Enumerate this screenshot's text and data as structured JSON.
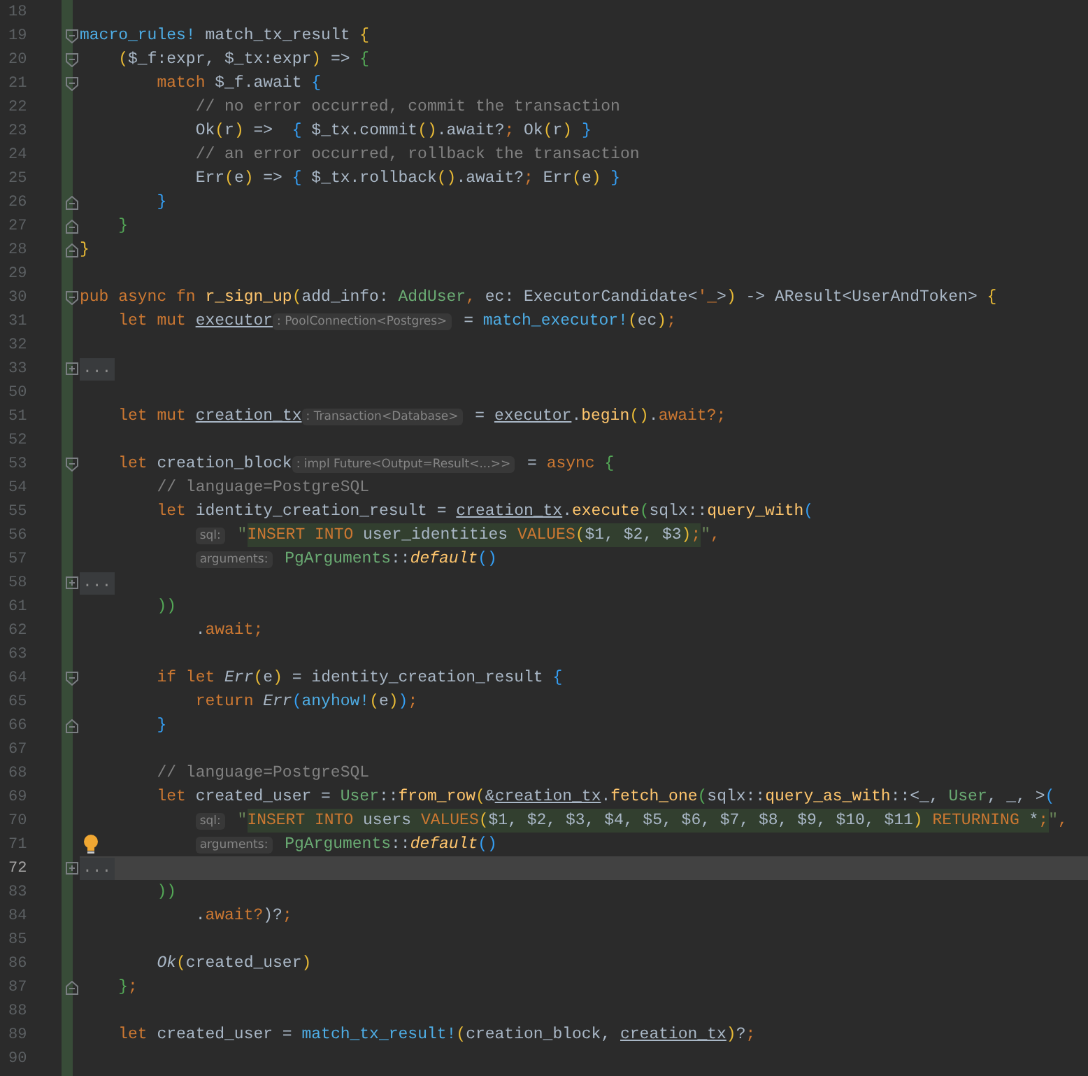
{
  "editor": {
    "lines": [
      {
        "number": "18",
        "kind": "plain",
        "current": false,
        "bulb": false
      },
      {
        "number": "19",
        "kind": "fold-start",
        "current": false,
        "bulb": false,
        "parts": [
          {
            "kind": "code",
            "tokens": [
              {
                "text": "macro_rules!",
                "kind": "macro"
              },
              {
                "text": " match_tx_result ",
                "kind": "plain"
              },
              {
                "text": "{",
                "kind": "bracket-yellow"
              }
            ]
          }
        ]
      },
      {
        "number": "20",
        "kind": "fold-start",
        "current": false,
        "bulb": false,
        "parts": [
          {
            "kind": "code",
            "tokens": [
              {
                "text": "    (",
                "kind": "bracket-yellow"
              },
              {
                "text": "$_f:expr, $_tx:expr",
                "kind": "plain"
              },
              {
                "text": ")",
                "kind": "bracket-yellow"
              },
              {
                "text": " => ",
                "kind": "plain"
              },
              {
                "text": "{",
                "kind": "bracket-green"
              }
            ]
          }
        ]
      },
      {
        "number": "21",
        "kind": "fold-start",
        "current": false,
        "bulb": false,
        "parts": [
          {
            "kind": "code",
            "tokens": [
              {
                "text": "        match",
                "kind": "keyword"
              },
              {
                "text": " $_f.await ",
                "kind": "plain"
              },
              {
                "text": "{",
                "kind": "bracket-blue"
              }
            ]
          }
        ]
      },
      {
        "number": "22",
        "kind": "plain",
        "current": false,
        "bulb": false,
        "parts": [
          {
            "kind": "code",
            "tokens": [
              {
                "text": "            // no error occurred, commit the transaction",
                "kind": "comment"
              }
            ]
          }
        ]
      },
      {
        "number": "23",
        "kind": "plain",
        "current": false,
        "bulb": false,
        "parts": [
          {
            "kind": "code",
            "tokens": [
              {
                "text": "            Ok",
                "kind": "plain"
              },
              {
                "text": "(",
                "kind": "bracket-yellow"
              },
              {
                "text": "r",
                "kind": "plain"
              },
              {
                "text": ")",
                "kind": "bracket-yellow"
              },
              {
                "text": " =>  ",
                "kind": "plain"
              },
              {
                "text": "{",
                "kind": "bracket-blue"
              },
              {
                "text": " $_tx.commit",
                "kind": "plain"
              },
              {
                "text": "()",
                "kind": "bracket-yellow"
              },
              {
                "text": ".await?",
                "kind": "plain"
              },
              {
                "text": ";",
                "kind": "keyword"
              },
              {
                "text": " Ok",
                "kind": "plain"
              },
              {
                "text": "(",
                "kind": "bracket-yellow"
              },
              {
                "text": "r",
                "kind": "plain"
              },
              {
                "text": ")",
                "kind": "bracket-yellow"
              },
              {
                "text": " }",
                "kind": "bracket-blue"
              }
            ]
          }
        ]
      },
      {
        "number": "24",
        "kind": "plain",
        "current": false,
        "bulb": false,
        "parts": [
          {
            "kind": "code",
            "tokens": [
              {
                "text": "            // an error occurred, rollback the transaction",
                "kind": "comment"
              }
            ]
          }
        ]
      },
      {
        "number": "25",
        "kind": "plain",
        "current": false,
        "bulb": false,
        "parts": [
          {
            "kind": "code",
            "tokens": [
              {
                "text": "            Err",
                "kind": "plain"
              },
              {
                "text": "(",
                "kind": "bracket-yellow"
              },
              {
                "text": "e",
                "kind": "plain"
              },
              {
                "text": ")",
                "kind": "bracket-yellow"
              },
              {
                "text": " => ",
                "kind": "plain"
              },
              {
                "text": "{",
                "kind": "bracket-blue"
              },
              {
                "text": " $_tx.rollback",
                "kind": "plain"
              },
              {
                "text": "()",
                "kind": "bracket-yellow"
              },
              {
                "text": ".await?",
                "kind": "plain"
              },
              {
                "text": ";",
                "kind": "keyword"
              },
              {
                "text": " Err",
                "kind": "plain"
              },
              {
                "text": "(",
                "kind": "bracket-yellow"
              },
              {
                "text": "e",
                "kind": "plain"
              },
              {
                "text": ")",
                "kind": "bracket-yellow"
              },
              {
                "text": " }",
                "kind": "bracket-blue"
              }
            ]
          }
        ]
      },
      {
        "number": "26",
        "kind": "fold-end",
        "current": false,
        "bulb": false,
        "parts": [
          {
            "kind": "code",
            "tokens": [
              {
                "text": "        }",
                "kind": "bracket-blue"
              }
            ]
          }
        ]
      },
      {
        "number": "27",
        "kind": "fold-end",
        "current": false,
        "bulb": false,
        "parts": [
          {
            "kind": "code",
            "tokens": [
              {
                "text": "    }",
                "kind": "bracket-green"
              }
            ]
          }
        ]
      },
      {
        "number": "28",
        "kind": "fold-end",
        "current": false,
        "bulb": false,
        "parts": [
          {
            "kind": "code",
            "tokens": [
              {
                "text": "}",
                "kind": "bracket-yellow"
              }
            ]
          }
        ]
      },
      {
        "number": "29",
        "kind": "plain",
        "current": false,
        "bulb": false
      },
      {
        "number": "30",
        "kind": "fold-start",
        "current": false,
        "bulb": false,
        "parts": [
          {
            "kind": "code",
            "tokens": [
              {
                "text": "pub async fn ",
                "kind": "keyword"
              },
              {
                "text": "r_sign_up",
                "kind": "function"
              },
              {
                "text": "(",
                "kind": "bracket-yellow"
              },
              {
                "text": "add_info: ",
                "kind": "plain"
              },
              {
                "text": "AddUser",
                "kind": "type"
              },
              {
                "text": ", ",
                "kind": "keyword"
              },
              {
                "text": "ec: ExecutorCandidate<",
                "kind": "plain"
              },
              {
                "text": "'_",
                "kind": "keyword"
              },
              {
                "text": ">",
                "kind": "plain"
              },
              {
                "text": ")",
                "kind": "bracket-yellow"
              },
              {
                "text": " -> AResult<UserAndToken> ",
                "kind": "plain"
              },
              {
                "text": "{",
                "kind": "bracket-yellow"
              }
            ]
          }
        ]
      },
      {
        "number": "31",
        "kind": "plain",
        "current": false,
        "bulb": false,
        "parts": [
          {
            "kind": "code",
            "tokens": [
              {
                "text": "    let mut ",
                "kind": "keyword"
              },
              {
                "text": "executor",
                "kind": "mutable"
              }
            ]
          },
          {
            "kind": "hint",
            "text": ": PoolConnection<Postgres>"
          },
          {
            "kind": "code",
            "tokens": [
              {
                "text": " = ",
                "kind": "plain"
              },
              {
                "text": "match_executor!",
                "kind": "macro"
              },
              {
                "text": "(",
                "kind": "bracket-yellow"
              },
              {
                "text": "ec",
                "kind": "plain"
              },
              {
                "text": ")",
                "kind": "bracket-yellow"
              },
              {
                "text": ";",
                "kind": "keyword"
              }
            ]
          }
        ]
      },
      {
        "number": "32",
        "kind": "plain",
        "current": false,
        "bulb": false
      },
      {
        "number": "33",
        "kind": "folded",
        "current": false,
        "bulb": false,
        "parts": [
          {
            "kind": "fold",
            "text": "..."
          }
        ]
      },
      {
        "number": "50",
        "kind": "plain",
        "current": false,
        "bulb": false
      },
      {
        "number": "51",
        "kind": "plain",
        "current": false,
        "bulb": false,
        "parts": [
          {
            "kind": "code",
            "tokens": [
              {
                "text": "    let mut ",
                "kind": "keyword"
              },
              {
                "text": "creation_tx",
                "kind": "mutable"
              }
            ]
          },
          {
            "kind": "hint",
            "text": ": Transaction<Database>"
          },
          {
            "kind": "code",
            "tokens": [
              {
                "text": " = ",
                "kind": "plain"
              },
              {
                "text": "executor",
                "kind": "mutable"
              },
              {
                "text": ".",
                "kind": "plain"
              },
              {
                "text": "begin",
                "kind": "function"
              },
              {
                "text": "()",
                "kind": "bracket-yellow"
              },
              {
                "text": ".",
                "kind": "plain"
              },
              {
                "text": "await?;",
                "kind": "keyword"
              }
            ]
          }
        ]
      },
      {
        "number": "52",
        "kind": "plain",
        "current": false,
        "bulb": false
      },
      {
        "number": "53",
        "kind": "fold-start",
        "current": false,
        "bulb": false,
        "parts": [
          {
            "kind": "code",
            "tokens": [
              {
                "text": "    let ",
                "kind": "keyword"
              },
              {
                "text": "creation_block",
                "kind": "plain"
              }
            ]
          },
          {
            "kind": "hint",
            "text": ": impl Future<Output=Result<...>>"
          },
          {
            "kind": "code",
            "tokens": [
              {
                "text": " = ",
                "kind": "plain"
              },
              {
                "text": "async ",
                "kind": "keyword"
              },
              {
                "text": "{",
                "kind": "bracket-green"
              }
            ]
          }
        ]
      },
      {
        "number": "54",
        "kind": "plain",
        "current": false,
        "bulb": false,
        "parts": [
          {
            "kind": "code",
            "tokens": [
              {
                "text": "        // language=PostgreSQL",
                "kind": "comment"
              }
            ]
          }
        ]
      },
      {
        "number": "55",
        "kind": "plain",
        "current": false,
        "bulb": false,
        "parts": [
          {
            "kind": "code",
            "tokens": [
              {
                "text": "        let ",
                "kind": "keyword"
              },
              {
                "text": "identity_creation_result = ",
                "kind": "plain"
              },
              {
                "text": "creation_tx",
                "kind": "mutable"
              },
              {
                "text": ".",
                "kind": "plain"
              },
              {
                "text": "execute",
                "kind": "function"
              },
              {
                "text": "(",
                "kind": "bracket-green"
              },
              {
                "text": "sqlx::",
                "kind": "plain"
              },
              {
                "text": "query_with",
                "kind": "function"
              },
              {
                "text": "(",
                "kind": "bracket-blue"
              }
            ]
          }
        ]
      },
      {
        "number": "56",
        "kind": "plain",
        "current": false,
        "bulb": false,
        "parts": [
          {
            "kind": "hint",
            "text": "            sql:"
          },
          {
            "kind": "code",
            "tokens": [
              {
                "text": " \"",
                "kind": "string"
              }
            ]
          },
          {
            "kind": "injected",
            "tokens": [
              {
                "text": "INSERT INTO",
                "kind": "keyword"
              },
              {
                "text": " user_identities ",
                "kind": "plain"
              },
              {
                "text": "VALUES",
                "kind": "keyword"
              },
              {
                "text": "(",
                "kind": "bracket-yellow"
              },
              {
                "text": "$1, $2, $3",
                "kind": "plain"
              },
              {
                "text": ")",
                "kind": "bracket-yellow"
              },
              {
                "text": ";",
                "kind": "keyword"
              }
            ]
          },
          {
            "kind": "code",
            "tokens": [
              {
                "text": "\"",
                "kind": "string"
              },
              {
                "text": ",",
                "kind": "keyword"
              }
            ]
          }
        ]
      },
      {
        "number": "57",
        "kind": "plain",
        "current": false,
        "bulb": false,
        "parts": [
          {
            "kind": "hint",
            "text": "            arguments:"
          },
          {
            "kind": "code",
            "tokens": [
              {
                "text": " PgArguments",
                "kind": "type"
              },
              {
                "text": "::",
                "kind": "plain"
              },
              {
                "text": "default",
                "kind": "static-function"
              },
              {
                "text": "()",
                "kind": "bracket-blue"
              }
            ]
          }
        ]
      },
      {
        "number": "58",
        "kind": "folded",
        "current": false,
        "bulb": false,
        "parts": [
          {
            "kind": "fold",
            "text": "..."
          }
        ]
      },
      {
        "number": "61",
        "kind": "plain",
        "current": false,
        "bulb": false,
        "parts": [
          {
            "kind": "code",
            "tokens": [
              {
                "text": "        ))",
                "kind": "bracket-green"
              }
            ]
          }
        ]
      },
      {
        "number": "62",
        "kind": "plain",
        "current": false,
        "bulb": false,
        "parts": [
          {
            "kind": "code",
            "tokens": [
              {
                "text": "            .",
                "kind": "plain"
              },
              {
                "text": "await;",
                "kind": "keyword"
              }
            ]
          }
        ]
      },
      {
        "number": "63",
        "kind": "plain",
        "current": false,
        "bulb": false
      },
      {
        "number": "64",
        "kind": "fold-start",
        "current": false,
        "bulb": false,
        "parts": [
          {
            "kind": "code",
            "tokens": [
              {
                "text": "        if let ",
                "kind": "keyword"
              },
              {
                "text": "Err",
                "kind": "variant"
              },
              {
                "text": "(",
                "kind": "bracket-yellow"
              },
              {
                "text": "e",
                "kind": "plain"
              },
              {
                "text": ")",
                "kind": "bracket-yellow"
              },
              {
                "text": " = identity_creation_result ",
                "kind": "plain"
              },
              {
                "text": "{",
                "kind": "bracket-blue"
              }
            ]
          }
        ]
      },
      {
        "number": "65",
        "kind": "plain",
        "current": false,
        "bulb": false,
        "parts": [
          {
            "kind": "code",
            "tokens": [
              {
                "text": "            return ",
                "kind": "keyword"
              },
              {
                "text": "Err",
                "kind": "variant"
              },
              {
                "text": "(",
                "kind": "bracket-blue"
              },
              {
                "text": "anyhow!",
                "kind": "macro"
              },
              {
                "text": "(",
                "kind": "bracket-yellow"
              },
              {
                "text": "e",
                "kind": "plain"
              },
              {
                "text": ")",
                "kind": "bracket-yellow"
              },
              {
                "text": ")",
                "kind": "bracket-blue"
              },
              {
                "text": ";",
                "kind": "keyword"
              }
            ]
          }
        ]
      },
      {
        "number": "66",
        "kind": "fold-end",
        "current": false,
        "bulb": false,
        "parts": [
          {
            "kind": "code",
            "tokens": [
              {
                "text": "        }",
                "kind": "bracket-blue"
              }
            ]
          }
        ]
      },
      {
        "number": "67",
        "kind": "plain",
        "current": false,
        "bulb": false
      },
      {
        "number": "68",
        "kind": "plain",
        "current": false,
        "bulb": false,
        "parts": [
          {
            "kind": "code",
            "tokens": [
              {
                "text": "        // language=PostgreSQL",
                "kind": "comment"
              }
            ]
          }
        ]
      },
      {
        "number": "69",
        "kind": "plain",
        "current": false,
        "bulb": false,
        "parts": [
          {
            "kind": "code",
            "tokens": [
              {
                "text": "        let ",
                "kind": "keyword"
              },
              {
                "text": "created_user = ",
                "kind": "plain"
              },
              {
                "text": "User",
                "kind": "type"
              },
              {
                "text": "::",
                "kind": "plain"
              },
              {
                "text": "from_row",
                "kind": "function"
              },
              {
                "text": "(",
                "kind": "bracket-yellow"
              },
              {
                "text": "&",
                "kind": "plain"
              },
              {
                "text": "creation_tx",
                "kind": "mutable"
              },
              {
                "text": ".",
                "kind": "plain"
              },
              {
                "text": "fetch_one",
                "kind": "function"
              },
              {
                "text": "(",
                "kind": "bracket-green"
              },
              {
                "text": "sqlx::",
                "kind": "plain"
              },
              {
                "text": "query_as_with",
                "kind": "function"
              },
              {
                "text": "::<_, ",
                "kind": "plain"
              },
              {
                "text": "User",
                "kind": "type"
              },
              {
                "text": ", _, >",
                "kind": "plain"
              },
              {
                "text": "(",
                "kind": "bracket-blue"
              }
            ]
          }
        ]
      },
      {
        "number": "70",
        "kind": "plain",
        "current": false,
        "bulb": false,
        "parts": [
          {
            "kind": "hint",
            "text": "            sql:"
          },
          {
            "kind": "code",
            "tokens": [
              {
                "text": " \"",
                "kind": "string"
              }
            ]
          },
          {
            "kind": "injected",
            "tokens": [
              {
                "text": "INSERT INTO",
                "kind": "keyword"
              },
              {
                "text": " users ",
                "kind": "plain"
              },
              {
                "text": "VALUES",
                "kind": "keyword"
              },
              {
                "text": "(",
                "kind": "bracket-yellow"
              },
              {
                "text": "$1, $2, $3, $4, $5, $6, $7, $8, $9, $10, $11",
                "kind": "plain"
              },
              {
                "text": ")",
                "kind": "bracket-yellow"
              },
              {
                "text": " RETURNING ",
                "kind": "keyword"
              },
              {
                "text": "*",
                "kind": "plain"
              },
              {
                "text": ";",
                "kind": "keyword"
              }
            ]
          },
          {
            "kind": "code",
            "tokens": [
              {
                "text": "\"",
                "kind": "string"
              },
              {
                "text": ",",
                "kind": "keyword"
              }
            ]
          }
        ]
      },
      {
        "number": "71",
        "kind": "plain",
        "current": false,
        "bulb": true,
        "parts": [
          {
            "kind": "hint",
            "text": "            arguments:"
          },
          {
            "kind": "code",
            "tokens": [
              {
                "text": " PgArguments",
                "kind": "type"
              },
              {
                "text": "::",
                "kind": "plain"
              },
              {
                "text": "default",
                "kind": "static-function"
              },
              {
                "text": "()",
                "kind": "bracket-blue"
              }
            ]
          }
        ]
      },
      {
        "number": "72",
        "kind": "folded",
        "current": true,
        "bulb": false,
        "parts": [
          {
            "kind": "fold",
            "text": "..."
          }
        ]
      },
      {
        "number": "83",
        "kind": "plain",
        "current": false,
        "bulb": false,
        "parts": [
          {
            "kind": "code",
            "tokens": [
              {
                "text": "        ))",
                "kind": "bracket-green"
              }
            ]
          }
        ]
      },
      {
        "number": "84",
        "kind": "plain",
        "current": false,
        "bulb": false,
        "parts": [
          {
            "kind": "code",
            "tokens": [
              {
                "text": "            .",
                "kind": "plain"
              },
              {
                "text": "await?",
                "kind": "keyword"
              },
              {
                "text": ")?",
                "kind": "plain"
              },
              {
                "text": ";",
                "kind": "keyword"
              }
            ]
          }
        ]
      },
      {
        "number": "85",
        "kind": "plain",
        "current": false,
        "bulb": false
      },
      {
        "number": "86",
        "kind": "plain",
        "current": false,
        "bulb": false,
        "parts": [
          {
            "kind": "code",
            "tokens": [
              {
                "text": "        Ok",
                "kind": "variant"
              },
              {
                "text": "(",
                "kind": "bracket-yellow"
              },
              {
                "text": "created_user",
                "kind": "plain"
              },
              {
                "text": ")",
                "kind": "bracket-yellow"
              }
            ]
          }
        ]
      },
      {
        "number": "87",
        "kind": "fold-end",
        "current": false,
        "bulb": false,
        "parts": [
          {
            "kind": "code",
            "tokens": [
              {
                "text": "    }",
                "kind": "bracket-green"
              },
              {
                "text": ";",
                "kind": "keyword"
              }
            ]
          }
        ]
      },
      {
        "number": "88",
        "kind": "plain",
        "current": false,
        "bulb": false
      },
      {
        "number": "89",
        "kind": "plain",
        "current": false,
        "bulb": false,
        "parts": [
          {
            "kind": "code",
            "tokens": [
              {
                "text": "    let ",
                "kind": "keyword"
              },
              {
                "text": "created_user = ",
                "kind": "plain"
              },
              {
                "text": "match_tx_result!",
                "kind": "macro"
              },
              {
                "text": "(",
                "kind": "bracket-yellow"
              },
              {
                "text": "creation_block, ",
                "kind": "plain"
              },
              {
                "text": "creation_tx",
                "kind": "mutable"
              },
              {
                "text": ")",
                "kind": "bracket-yellow"
              },
              {
                "text": "?",
                "kind": "plain"
              },
              {
                "text": ";",
                "kind": "keyword"
              }
            ]
          }
        ]
      },
      {
        "number": "90",
        "kind": "plain",
        "current": false,
        "bulb": false
      }
    ]
  }
}
